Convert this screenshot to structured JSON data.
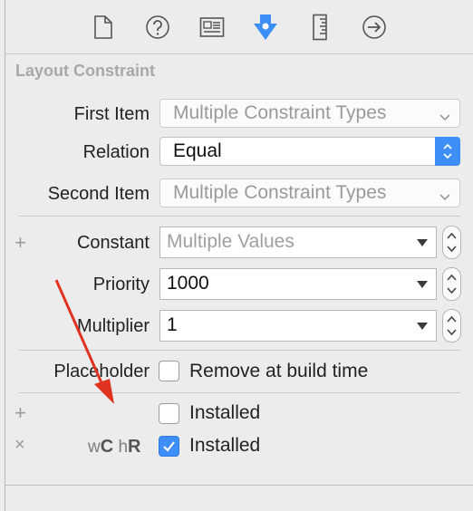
{
  "toolbar": {
    "icons": [
      "file-inspector-icon",
      "quick-help-icon",
      "identity-inspector-icon",
      "attributes-inspector-icon",
      "size-inspector-icon",
      "connections-inspector-icon"
    ]
  },
  "section": {
    "title": "Layout Constraint"
  },
  "first_item": {
    "label": "First Item",
    "value": "Multiple Constraint Types"
  },
  "relation": {
    "label": "Relation",
    "value": "Equal"
  },
  "second_item": {
    "label": "Second Item",
    "value": "Multiple Constraint Types"
  },
  "constant": {
    "label": "Constant",
    "placeholder": "Multiple Values",
    "plus": "+"
  },
  "priority": {
    "label": "Priority",
    "value": "1000"
  },
  "multiplier": {
    "label": "Multiplier",
    "value": "1"
  },
  "placeholder_row": {
    "label": "Placeholder",
    "checkbox_label": "Remove at build time",
    "checked": false
  },
  "installed_rows": [
    {
      "prefix": "+",
      "label": "Installed",
      "checked": false
    },
    {
      "prefix": "×",
      "size_w": "w",
      "size_c": "C",
      "size_h": "h",
      "size_r": "R",
      "label": "Installed",
      "checked": true
    }
  ],
  "colors": {
    "accent": "#3d8ef6",
    "annotation_arrow": "#e0331f"
  }
}
